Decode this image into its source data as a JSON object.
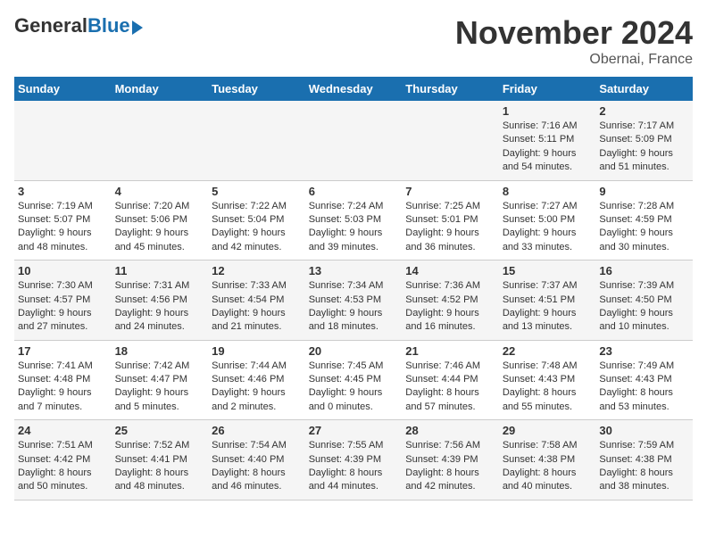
{
  "logo": {
    "general": "General",
    "blue": "Blue"
  },
  "title": "November 2024",
  "location": "Obernai, France",
  "days_header": [
    "Sunday",
    "Monday",
    "Tuesday",
    "Wednesday",
    "Thursday",
    "Friday",
    "Saturday"
  ],
  "weeks": [
    [
      {
        "day": "",
        "info": ""
      },
      {
        "day": "",
        "info": ""
      },
      {
        "day": "",
        "info": ""
      },
      {
        "day": "",
        "info": ""
      },
      {
        "day": "",
        "info": ""
      },
      {
        "day": "1",
        "info": "Sunrise: 7:16 AM\nSunset: 5:11 PM\nDaylight: 9 hours\nand 54 minutes."
      },
      {
        "day": "2",
        "info": "Sunrise: 7:17 AM\nSunset: 5:09 PM\nDaylight: 9 hours\nand 51 minutes."
      }
    ],
    [
      {
        "day": "3",
        "info": "Sunrise: 7:19 AM\nSunset: 5:07 PM\nDaylight: 9 hours\nand 48 minutes."
      },
      {
        "day": "4",
        "info": "Sunrise: 7:20 AM\nSunset: 5:06 PM\nDaylight: 9 hours\nand 45 minutes."
      },
      {
        "day": "5",
        "info": "Sunrise: 7:22 AM\nSunset: 5:04 PM\nDaylight: 9 hours\nand 42 minutes."
      },
      {
        "day": "6",
        "info": "Sunrise: 7:24 AM\nSunset: 5:03 PM\nDaylight: 9 hours\nand 39 minutes."
      },
      {
        "day": "7",
        "info": "Sunrise: 7:25 AM\nSunset: 5:01 PM\nDaylight: 9 hours\nand 36 minutes."
      },
      {
        "day": "8",
        "info": "Sunrise: 7:27 AM\nSunset: 5:00 PM\nDaylight: 9 hours\nand 33 minutes."
      },
      {
        "day": "9",
        "info": "Sunrise: 7:28 AM\nSunset: 4:59 PM\nDaylight: 9 hours\nand 30 minutes."
      }
    ],
    [
      {
        "day": "10",
        "info": "Sunrise: 7:30 AM\nSunset: 4:57 PM\nDaylight: 9 hours\nand 27 minutes."
      },
      {
        "day": "11",
        "info": "Sunrise: 7:31 AM\nSunset: 4:56 PM\nDaylight: 9 hours\nand 24 minutes."
      },
      {
        "day": "12",
        "info": "Sunrise: 7:33 AM\nSunset: 4:54 PM\nDaylight: 9 hours\nand 21 minutes."
      },
      {
        "day": "13",
        "info": "Sunrise: 7:34 AM\nSunset: 4:53 PM\nDaylight: 9 hours\nand 18 minutes."
      },
      {
        "day": "14",
        "info": "Sunrise: 7:36 AM\nSunset: 4:52 PM\nDaylight: 9 hours\nand 16 minutes."
      },
      {
        "day": "15",
        "info": "Sunrise: 7:37 AM\nSunset: 4:51 PM\nDaylight: 9 hours\nand 13 minutes."
      },
      {
        "day": "16",
        "info": "Sunrise: 7:39 AM\nSunset: 4:50 PM\nDaylight: 9 hours\nand 10 minutes."
      }
    ],
    [
      {
        "day": "17",
        "info": "Sunrise: 7:41 AM\nSunset: 4:48 PM\nDaylight: 9 hours\nand 7 minutes."
      },
      {
        "day": "18",
        "info": "Sunrise: 7:42 AM\nSunset: 4:47 PM\nDaylight: 9 hours\nand 5 minutes."
      },
      {
        "day": "19",
        "info": "Sunrise: 7:44 AM\nSunset: 4:46 PM\nDaylight: 9 hours\nand 2 minutes."
      },
      {
        "day": "20",
        "info": "Sunrise: 7:45 AM\nSunset: 4:45 PM\nDaylight: 9 hours\nand 0 minutes."
      },
      {
        "day": "21",
        "info": "Sunrise: 7:46 AM\nSunset: 4:44 PM\nDaylight: 8 hours\nand 57 minutes."
      },
      {
        "day": "22",
        "info": "Sunrise: 7:48 AM\nSunset: 4:43 PM\nDaylight: 8 hours\nand 55 minutes."
      },
      {
        "day": "23",
        "info": "Sunrise: 7:49 AM\nSunset: 4:43 PM\nDaylight: 8 hours\nand 53 minutes."
      }
    ],
    [
      {
        "day": "24",
        "info": "Sunrise: 7:51 AM\nSunset: 4:42 PM\nDaylight: 8 hours\nand 50 minutes."
      },
      {
        "day": "25",
        "info": "Sunrise: 7:52 AM\nSunset: 4:41 PM\nDaylight: 8 hours\nand 48 minutes."
      },
      {
        "day": "26",
        "info": "Sunrise: 7:54 AM\nSunset: 4:40 PM\nDaylight: 8 hours\nand 46 minutes."
      },
      {
        "day": "27",
        "info": "Sunrise: 7:55 AM\nSunset: 4:39 PM\nDaylight: 8 hours\nand 44 minutes."
      },
      {
        "day": "28",
        "info": "Sunrise: 7:56 AM\nSunset: 4:39 PM\nDaylight: 8 hours\nand 42 minutes."
      },
      {
        "day": "29",
        "info": "Sunrise: 7:58 AM\nSunset: 4:38 PM\nDaylight: 8 hours\nand 40 minutes."
      },
      {
        "day": "30",
        "info": "Sunrise: 7:59 AM\nSunset: 4:38 PM\nDaylight: 8 hours\nand 38 minutes."
      }
    ]
  ]
}
